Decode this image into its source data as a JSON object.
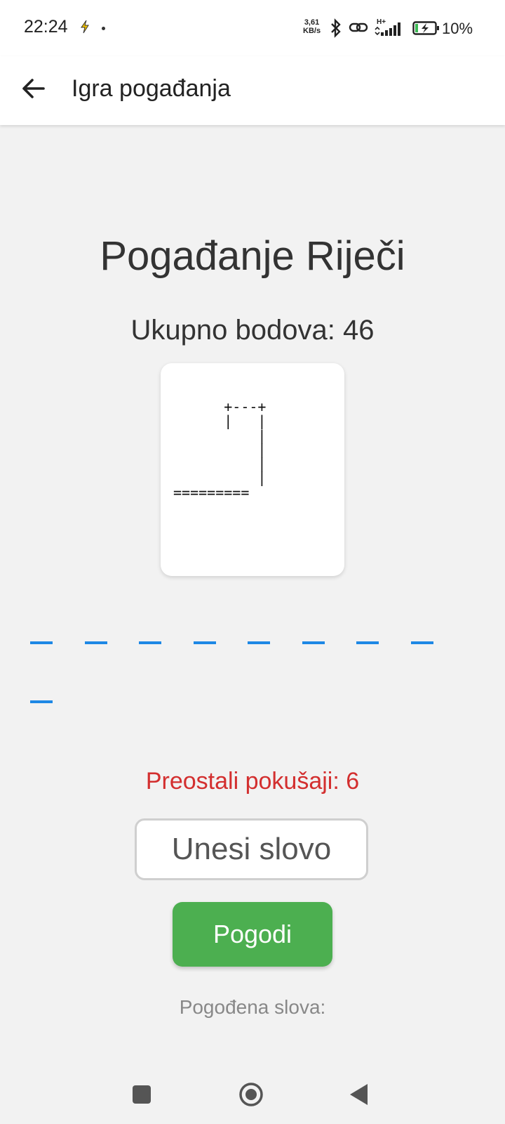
{
  "status_bar": {
    "time": "22:24",
    "speed_value": "3,61",
    "speed_unit": "KB/s",
    "network": "H+",
    "battery": "10%"
  },
  "app_bar": {
    "title": "Igra pogađanja",
    "back_icon": "arrow-back-icon"
  },
  "game": {
    "title": "Pogađanje Riječi",
    "score_text": "Ukupno bodova: 46",
    "hangman_ascii": "      +---+\n      |   |\n          |\n          |\n          |\n          |\n=========",
    "letter_count": 9,
    "attempts_text": "Preostali pokušaji: 6",
    "input_placeholder": "Unesi slovo",
    "guess_button_label": "Pogodi",
    "guessed_letters_label": "Pogođena slova:"
  },
  "colors": {
    "slot": "#1e88e5",
    "attempts": "#d32f2f",
    "button": "#4caf50"
  },
  "nav_bar": {
    "recents_icon": "square-recents-icon",
    "home_icon": "circle-home-icon",
    "back_icon": "triangle-back-icon"
  }
}
